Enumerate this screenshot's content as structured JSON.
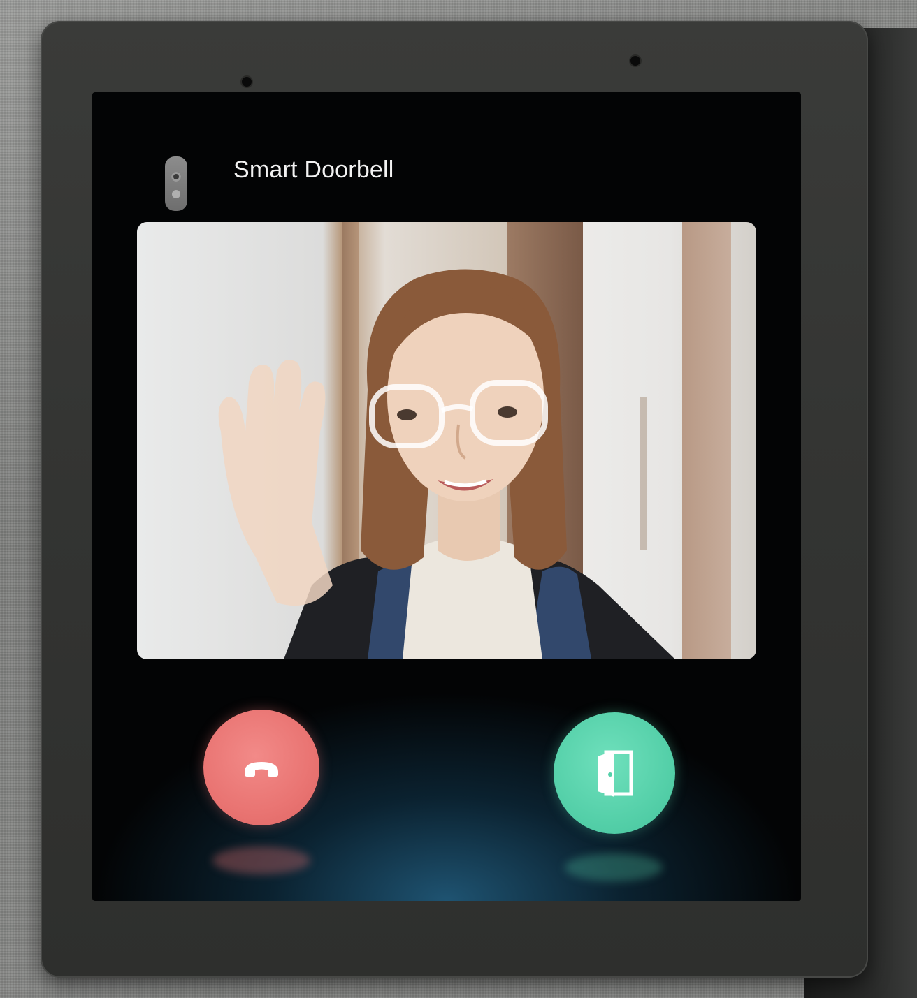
{
  "device": {
    "app_title": "Smart Doorbell",
    "header_icon": "doorbell-icon"
  },
  "video_feed": {
    "description_icon": "live-camera-feed"
  },
  "actions": {
    "decline": {
      "icon": "hang-up-icon",
      "color": "#E97472"
    },
    "open_door": {
      "icon": "door-open-icon",
      "color": "#55D0A9"
    }
  },
  "theme": {
    "screen_background": "#030405",
    "glow_color": "#286E96",
    "title_color": "#F2F2F2"
  }
}
